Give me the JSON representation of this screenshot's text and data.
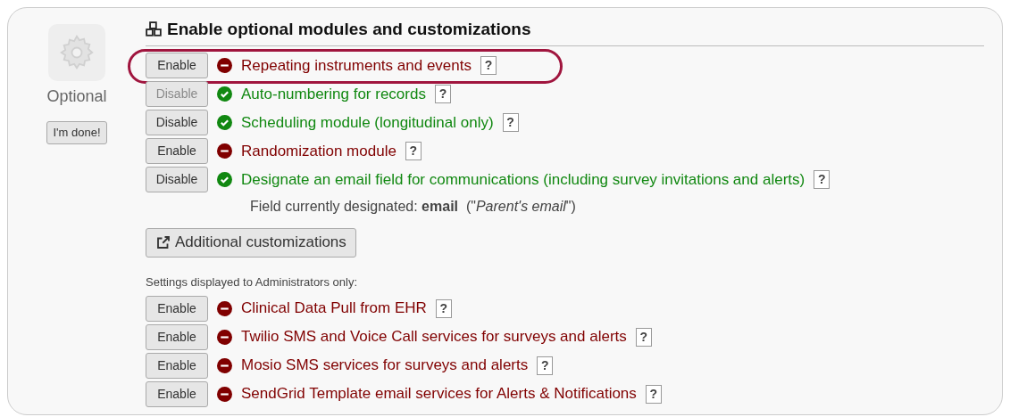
{
  "sidebar": {
    "label": "Optional",
    "done_button": "I'm done!"
  },
  "heading": "Enable optional modules and customizations",
  "modules": [
    {
      "button": "Enable",
      "enabled": false,
      "disabled": false,
      "label": "Repeating instruments and events",
      "help": "?",
      "highlighted": true
    },
    {
      "button": "Disable",
      "enabled": true,
      "disabled": true,
      "label": "Auto-numbering for records",
      "help": "?",
      "highlighted": false
    },
    {
      "button": "Disable",
      "enabled": true,
      "disabled": false,
      "label": "Scheduling module (longitudinal only)",
      "help": "?",
      "highlighted": false
    },
    {
      "button": "Enable",
      "enabled": false,
      "disabled": false,
      "label": "Randomization module",
      "help": "?",
      "highlighted": false
    },
    {
      "button": "Disable",
      "enabled": true,
      "disabled": false,
      "label": "Designate an email field for communications (including survey invitations and alerts)",
      "help": "?",
      "highlighted": false
    }
  ],
  "email_note": "Field currently designated: **email**  (\"*Parent's email*\")",
  "customizations_button": "Additional customizations",
  "admin_note": "Settings displayed to Administrators only:",
  "admin_modules": [
    {
      "button": "Enable",
      "enabled": false,
      "disabled": false,
      "label": "Clinical Data Pull from EHR",
      "help": "?"
    },
    {
      "button": "Enable",
      "enabled": false,
      "disabled": false,
      "label": "Twilio SMS and Voice Call services for surveys and alerts",
      "help": "?"
    },
    {
      "button": "Enable",
      "enabled": false,
      "disabled": false,
      "label": "Mosio SMS services for surveys and alerts",
      "help": "?"
    },
    {
      "button": "Enable",
      "enabled": false,
      "disabled": false,
      "label": "SendGrid Template email services for Alerts & Notifications",
      "help": "?"
    }
  ]
}
